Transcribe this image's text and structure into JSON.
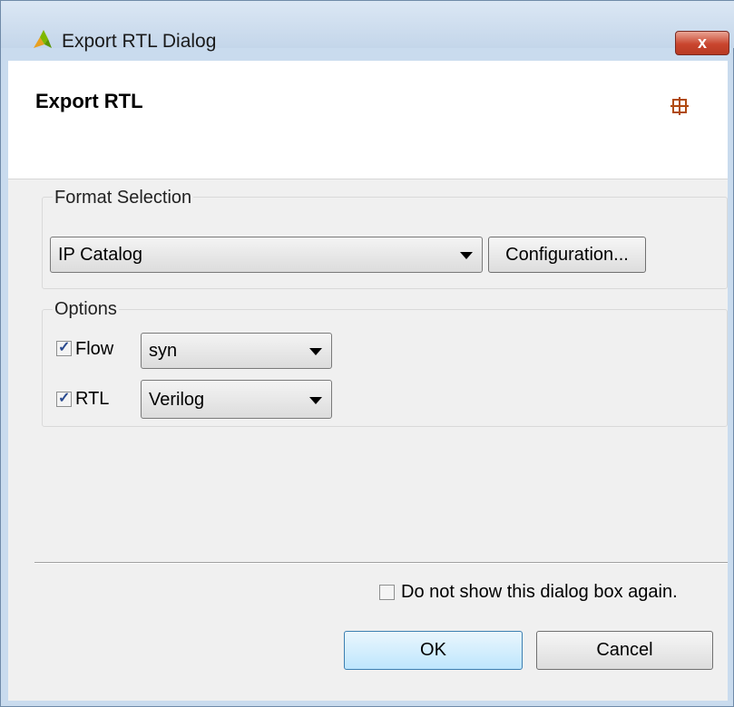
{
  "window": {
    "title": "Export RTL Dialog",
    "close_glyph": "x"
  },
  "header": {
    "title": "Export RTL"
  },
  "format_selection": {
    "group_label": "Format Selection",
    "format_value": "IP Catalog",
    "configuration_button": "Configuration..."
  },
  "options": {
    "group_label": "Options",
    "flow": {
      "label": "Flow",
      "checked": true,
      "value": "syn"
    },
    "rtl": {
      "label": "RTL",
      "checked": true,
      "value": "Verilog"
    }
  },
  "footer": {
    "dont_show_label": "Do not show this dialog box again.",
    "dont_show_checked": false,
    "ok_label": "OK",
    "cancel_label": "Cancel"
  },
  "icons": {
    "app": "xilinx-logo-icon",
    "header": "crosshair-grid-icon",
    "checkmark": "✓"
  },
  "colors": {
    "titlebar": "#c4d6ea",
    "close_button": "#c9452e",
    "ok_button": "#bee6fd"
  }
}
